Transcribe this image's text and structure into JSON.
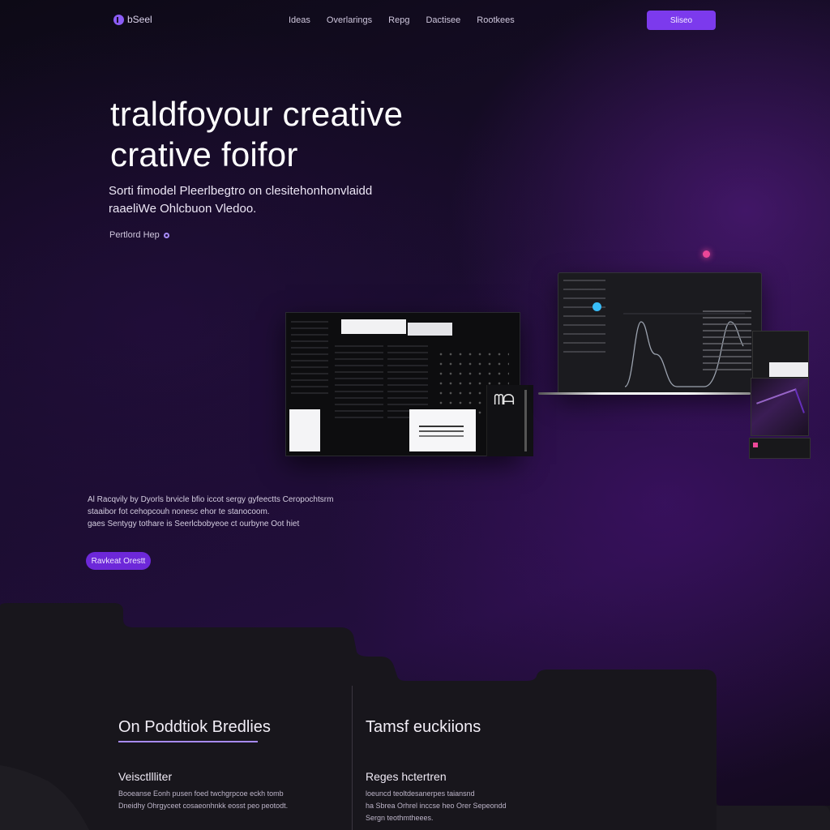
{
  "nav": {
    "logo_text": "bSeel",
    "links": [
      "Ideas",
      "Overlarings",
      "Repg",
      "Dactisee",
      "Rootkees"
    ],
    "cta_label": "Sliseo"
  },
  "hero": {
    "title_line1": "traldfoyour creative",
    "title_line2": "crative foifor",
    "subtitle_line1": "Sorti fimodel Pleerlbegtro on clesitehonhonvlaidd",
    "subtitle_line2": "raaeliWe Ohlcbuon Vledoo.",
    "link_label": "Pertlord Hep"
  },
  "description": {
    "line1": "Al Racqvily by Dyorls brvicle bfio iccot sergy gyfeectts Ceropochtsrm",
    "line2": "staaibor fot cehopcouh nonesc ehor te stanocoom.",
    "line3": "gaes Sentygy tothare is Seerlcbobyeoe ct ourbyne Oot hiet",
    "cta_label": "Ravkeat Orestt"
  },
  "features": {
    "left": {
      "title": "On Poddtiok Bredlies",
      "sub_title": "Veisctllliter",
      "text_line1": "Booeanse Eonh pusen foed twchgrpcoe eckh tomb",
      "text_line2": "Dneidhy Ohrgyceet cosaeonhnkk eosst peo peotodt."
    },
    "right": {
      "title": "Tamsf euckiions",
      "sub_title": "Reges hctertren",
      "text_line1": "loeuncd teoltdesanerpes taiansnd",
      "text_line2": "ha Sbrea Orhrel inccse heo Orer Sepeondd",
      "text_line3": "Sergn teothmtheees."
    }
  },
  "colors": {
    "accent": "#7c3aed",
    "accent_light": "#a78bfa",
    "pink": "#ec4899",
    "blue": "#38bdf8"
  }
}
